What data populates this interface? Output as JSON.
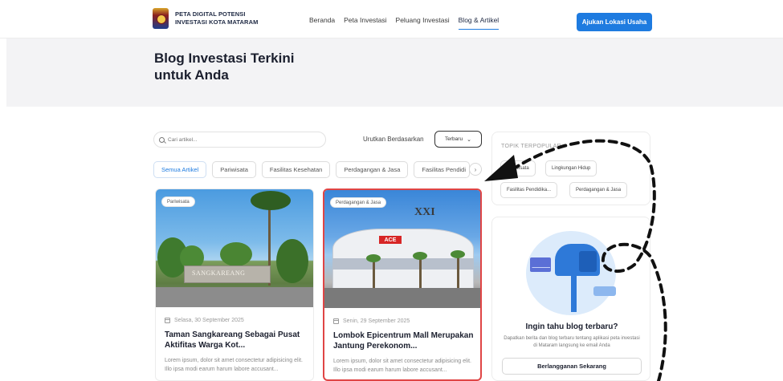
{
  "header": {
    "logo_line1": "PETA DIGITAL POTENSI",
    "logo_line2": "INVESTASI KOTA MATARAM",
    "nav": [
      {
        "label": "Beranda",
        "active": false
      },
      {
        "label": "Peta Investasi",
        "active": false
      },
      {
        "label": "Peluang Investasi",
        "active": false
      },
      {
        "label": "Blog & Artikel",
        "active": true
      }
    ],
    "cta_label": "Ajukan Lokasi Usaha"
  },
  "hero": {
    "title_line1": "Blog Investasi Terkini",
    "title_line2": "untuk Anda"
  },
  "toolbar": {
    "search_placeholder": "Cari artikel...",
    "sort_label": "Urutkan Berdasarkan",
    "sort_value": "Terbaru"
  },
  "categories": [
    {
      "label": "Semua Artikel",
      "active": true
    },
    {
      "label": "Pariwisata",
      "active": false
    },
    {
      "label": "Fasilitas Kesehatan",
      "active": false
    },
    {
      "label": "Perdagangan & Jasa",
      "active": false
    },
    {
      "label": "Fasilitas Pendidi",
      "active": false
    }
  ],
  "articles": [
    {
      "category": "Pariwisata",
      "date": "Selasa, 30 September 2025",
      "title_line1": "Taman Sangkareang Sebagai Pusat",
      "title_line2": "Aktifitas Warga Kot...",
      "excerpt": "Lorem ipsum, dolor sit amet consectetur adipisicing elit. Illo ipsa modi earum harum labore accusant...",
      "image_caption": "SANGKAREANG"
    },
    {
      "category": "Perdagangan & Jasa",
      "date": "Senin, 29 September 2025",
      "title_line1": "Lombok Epicentrum Mall Merupakan",
      "title_line2": "Jantung Perekonom...",
      "excerpt": "Lorem ipsum, dolor sit amet consectetur adipisicing elit. Illo ipsa modi earum harum labore accusant...",
      "image_sign": "ACE",
      "image_logo": "XXI"
    }
  ],
  "topics": {
    "label": "TOPIK TERPOPULAR",
    "tags": [
      "Pariwisata",
      "Lingkungan Hidup",
      "Fasilitas Pendidika...",
      "Perdagangan & Jasa"
    ]
  },
  "newsletter": {
    "title": "Ingin tahu blog terbaru?",
    "desc": "Dapatkan berita dan blog terbaru tentang aplikasi peta investasi di Mataram langsung ke email Anda",
    "button": "Berlangganan Sekarang"
  },
  "colors": {
    "accent": "#1e7be0",
    "highlight_border": "#e04545",
    "hero_bg": "#f3f3f5"
  }
}
